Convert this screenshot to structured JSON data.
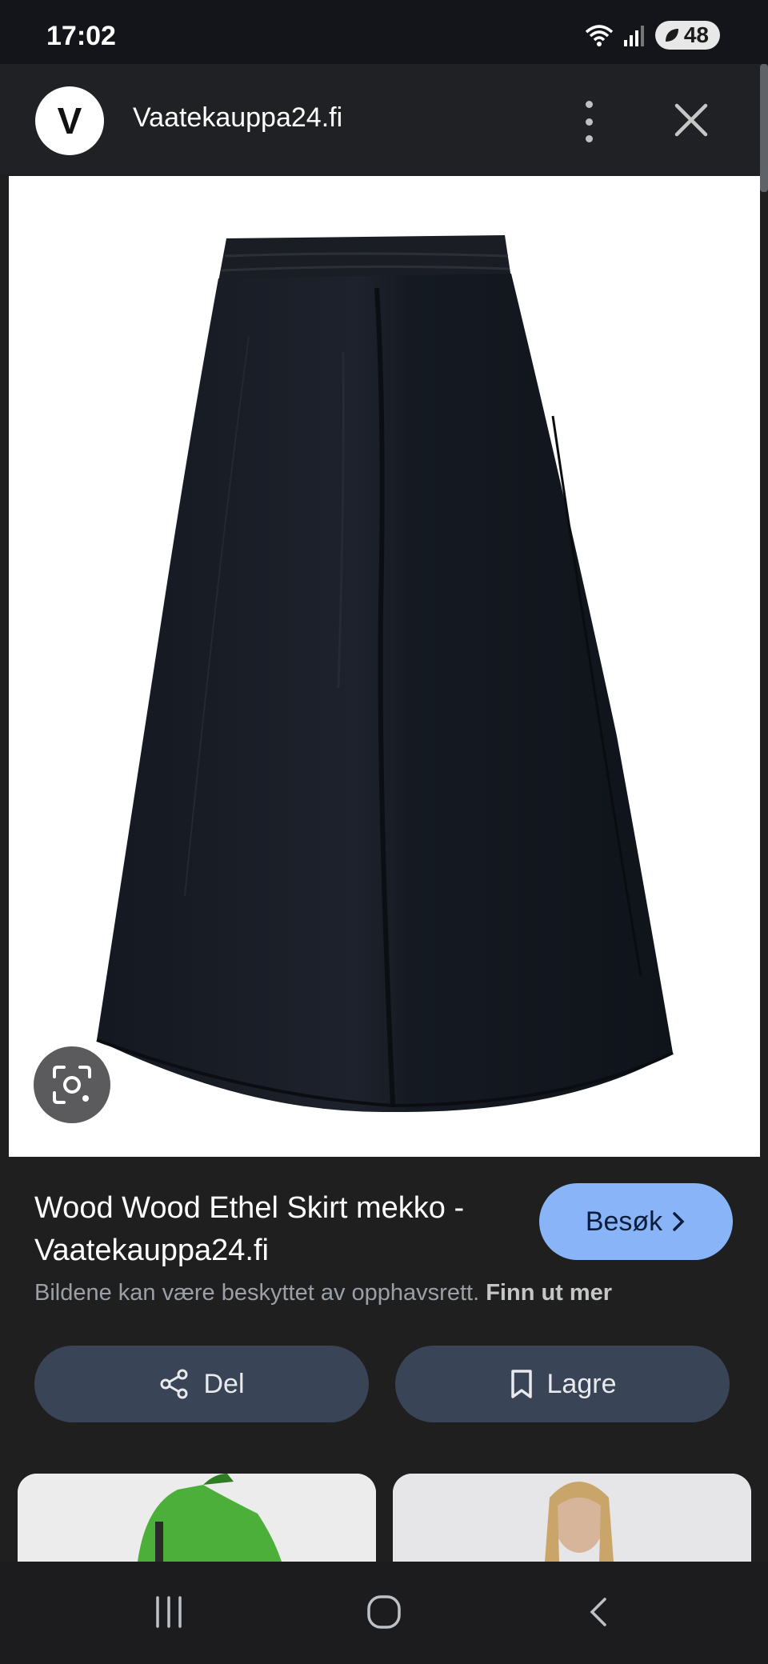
{
  "status_bar": {
    "time": "17:02",
    "battery": "48"
  },
  "header": {
    "site_initial": "V",
    "site_name": "Vaatekauppa24.fi"
  },
  "result": {
    "title": "Wood Wood Ethel Skirt mekko - Vaatekauppa24.fi",
    "visit_label": "Besøk",
    "copyright_text": "Bildene kan være beskyttet av opphavsrett.",
    "learn_more_label": "Finn ut mer"
  },
  "actions": {
    "share_label": "Del",
    "save_label": "Lagre"
  },
  "icons": {
    "wifi": "wifi-icon",
    "signal": "signal-icon",
    "more": "more-vert-icon",
    "close": "close-icon",
    "lens": "lens-icon",
    "chevron": "chevron-right-icon",
    "share": "share-icon",
    "bookmark": "bookmark-icon",
    "recents": "recents-icon",
    "home": "home-icon",
    "back": "back-icon"
  },
  "colors": {
    "accent": "#8ab4f8",
    "button_bg": "#394457",
    "background": "#1f1f1f"
  }
}
